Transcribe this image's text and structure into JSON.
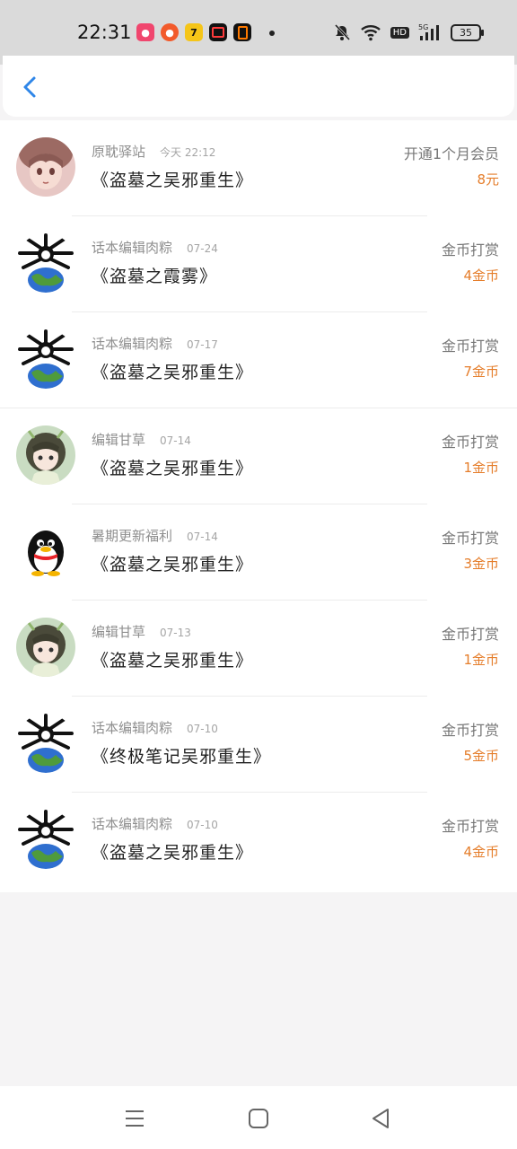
{
  "status": {
    "time": "22:31",
    "hd": "HD",
    "battery": "35"
  },
  "header": {
    "back_icon": "chevron-left-icon"
  },
  "rows": [
    {
      "name": "原耽驿站",
      "date": "今天 22:12",
      "title": "《盗墓之吴邪重生》",
      "type": "开通1个月会员",
      "amount": "8元",
      "avatar": "anime-girl"
    },
    {
      "name": "话本编辑肉粽",
      "date": "07-24",
      "title": "《盗墓之霞雾》",
      "type": "金币打赏",
      "amount": "4金币",
      "avatar": "bug-globe"
    },
    {
      "name": "话本编辑肉粽",
      "date": "07-17",
      "title": "《盗墓之吴邪重生》",
      "type": "金币打赏",
      "amount": "7金币",
      "avatar": "bug-globe"
    },
    {
      "name": "编辑甘草",
      "date": "07-14",
      "title": "《盗墓之吴邪重生》",
      "type": "金币打赏",
      "amount": "1金币",
      "avatar": "green-girl"
    },
    {
      "name": "暑期更新福利",
      "date": "07-14",
      "title": "《盗墓之吴邪重生》",
      "type": "金币打赏",
      "amount": "3金币",
      "avatar": "penguin"
    },
    {
      "name": "编辑甘草",
      "date": "07-13",
      "title": "《盗墓之吴邪重生》",
      "type": "金币打赏",
      "amount": "1金币",
      "avatar": "green-girl"
    },
    {
      "name": "话本编辑肉粽",
      "date": "07-10",
      "title": "《终极笔记吴邪重生》",
      "type": "金币打赏",
      "amount": "5金币",
      "avatar": "bug-globe"
    },
    {
      "name": "话本编辑肉粽",
      "date": "07-10",
      "title": "《盗墓之吴邪重生》",
      "type": "金币打赏",
      "amount": "4金币",
      "avatar": "bug-globe"
    }
  ],
  "colors": {
    "accent": "#2f86e8",
    "amount": "#e57d2a"
  }
}
